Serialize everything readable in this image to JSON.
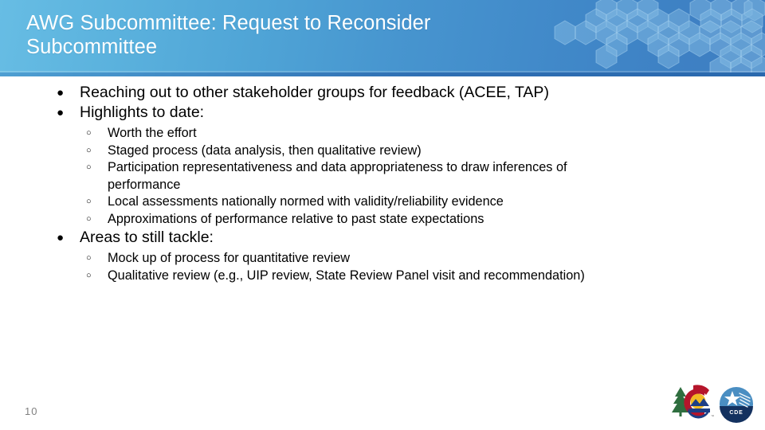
{
  "slide": {
    "title": "AWG Subcommittee: Request to Reconsider Subcommittee",
    "page_number": "10",
    "colors": {
      "header_light_blue": "#67bde4",
      "header_dark_blue": "#3d7dc1",
      "header_edge": "#2a69ae",
      "body_background": "#ffffff",
      "body_text": "#000000",
      "page_number_text": "#808080",
      "logo_green": "#2f6e3f",
      "logo_red": "#b5152b",
      "logo_yellow": "#f2b923",
      "logo_blue": "#1d3f86",
      "cde_blue": "#4a8ec2",
      "cde_navy": "#13315f"
    },
    "bullets": [
      {
        "marker": "bullet-filled-circle",
        "text": "Reaching out to other stakeholder groups for feedback (ACEE, TAP)",
        "children": []
      },
      {
        "marker": "bullet-filled-circle",
        "text": "Highlights to date:",
        "children": [
          {
            "marker": "bullet-hollow-circle",
            "text": "Worth the effort"
          },
          {
            "marker": "bullet-hollow-circle",
            "text": "Staged process (data analysis, then qualitative review)"
          },
          {
            "marker": "bullet-hollow-circle",
            "text": "Participation representativeness and data appropriateness to draw inferences of performance"
          },
          {
            "marker": "bullet-hollow-circle",
            "text": "Local assessments nationally normed with validity/reliability evidence"
          },
          {
            "marker": "bullet-hollow-circle",
            "text": "Approximations of performance relative to past state expectations"
          }
        ]
      },
      {
        "marker": "bullet-filled-circle",
        "text": "Areas to still tackle:",
        "children": [
          {
            "marker": "bullet-hollow-circle",
            "text": "Mock up of process for quantitative review"
          },
          {
            "marker": "bullet-hollow-circle",
            "text": "Qualitative review (e.g., UIP review, State Review Panel visit and recommendation)"
          }
        ]
      }
    ],
    "logos": [
      {
        "name": "colorado-state-logo",
        "label": "Colorado"
      },
      {
        "name": "cde-logo",
        "label": "CDE"
      }
    ],
    "markers": {
      "filled": "●",
      "hollow": "○"
    }
  }
}
